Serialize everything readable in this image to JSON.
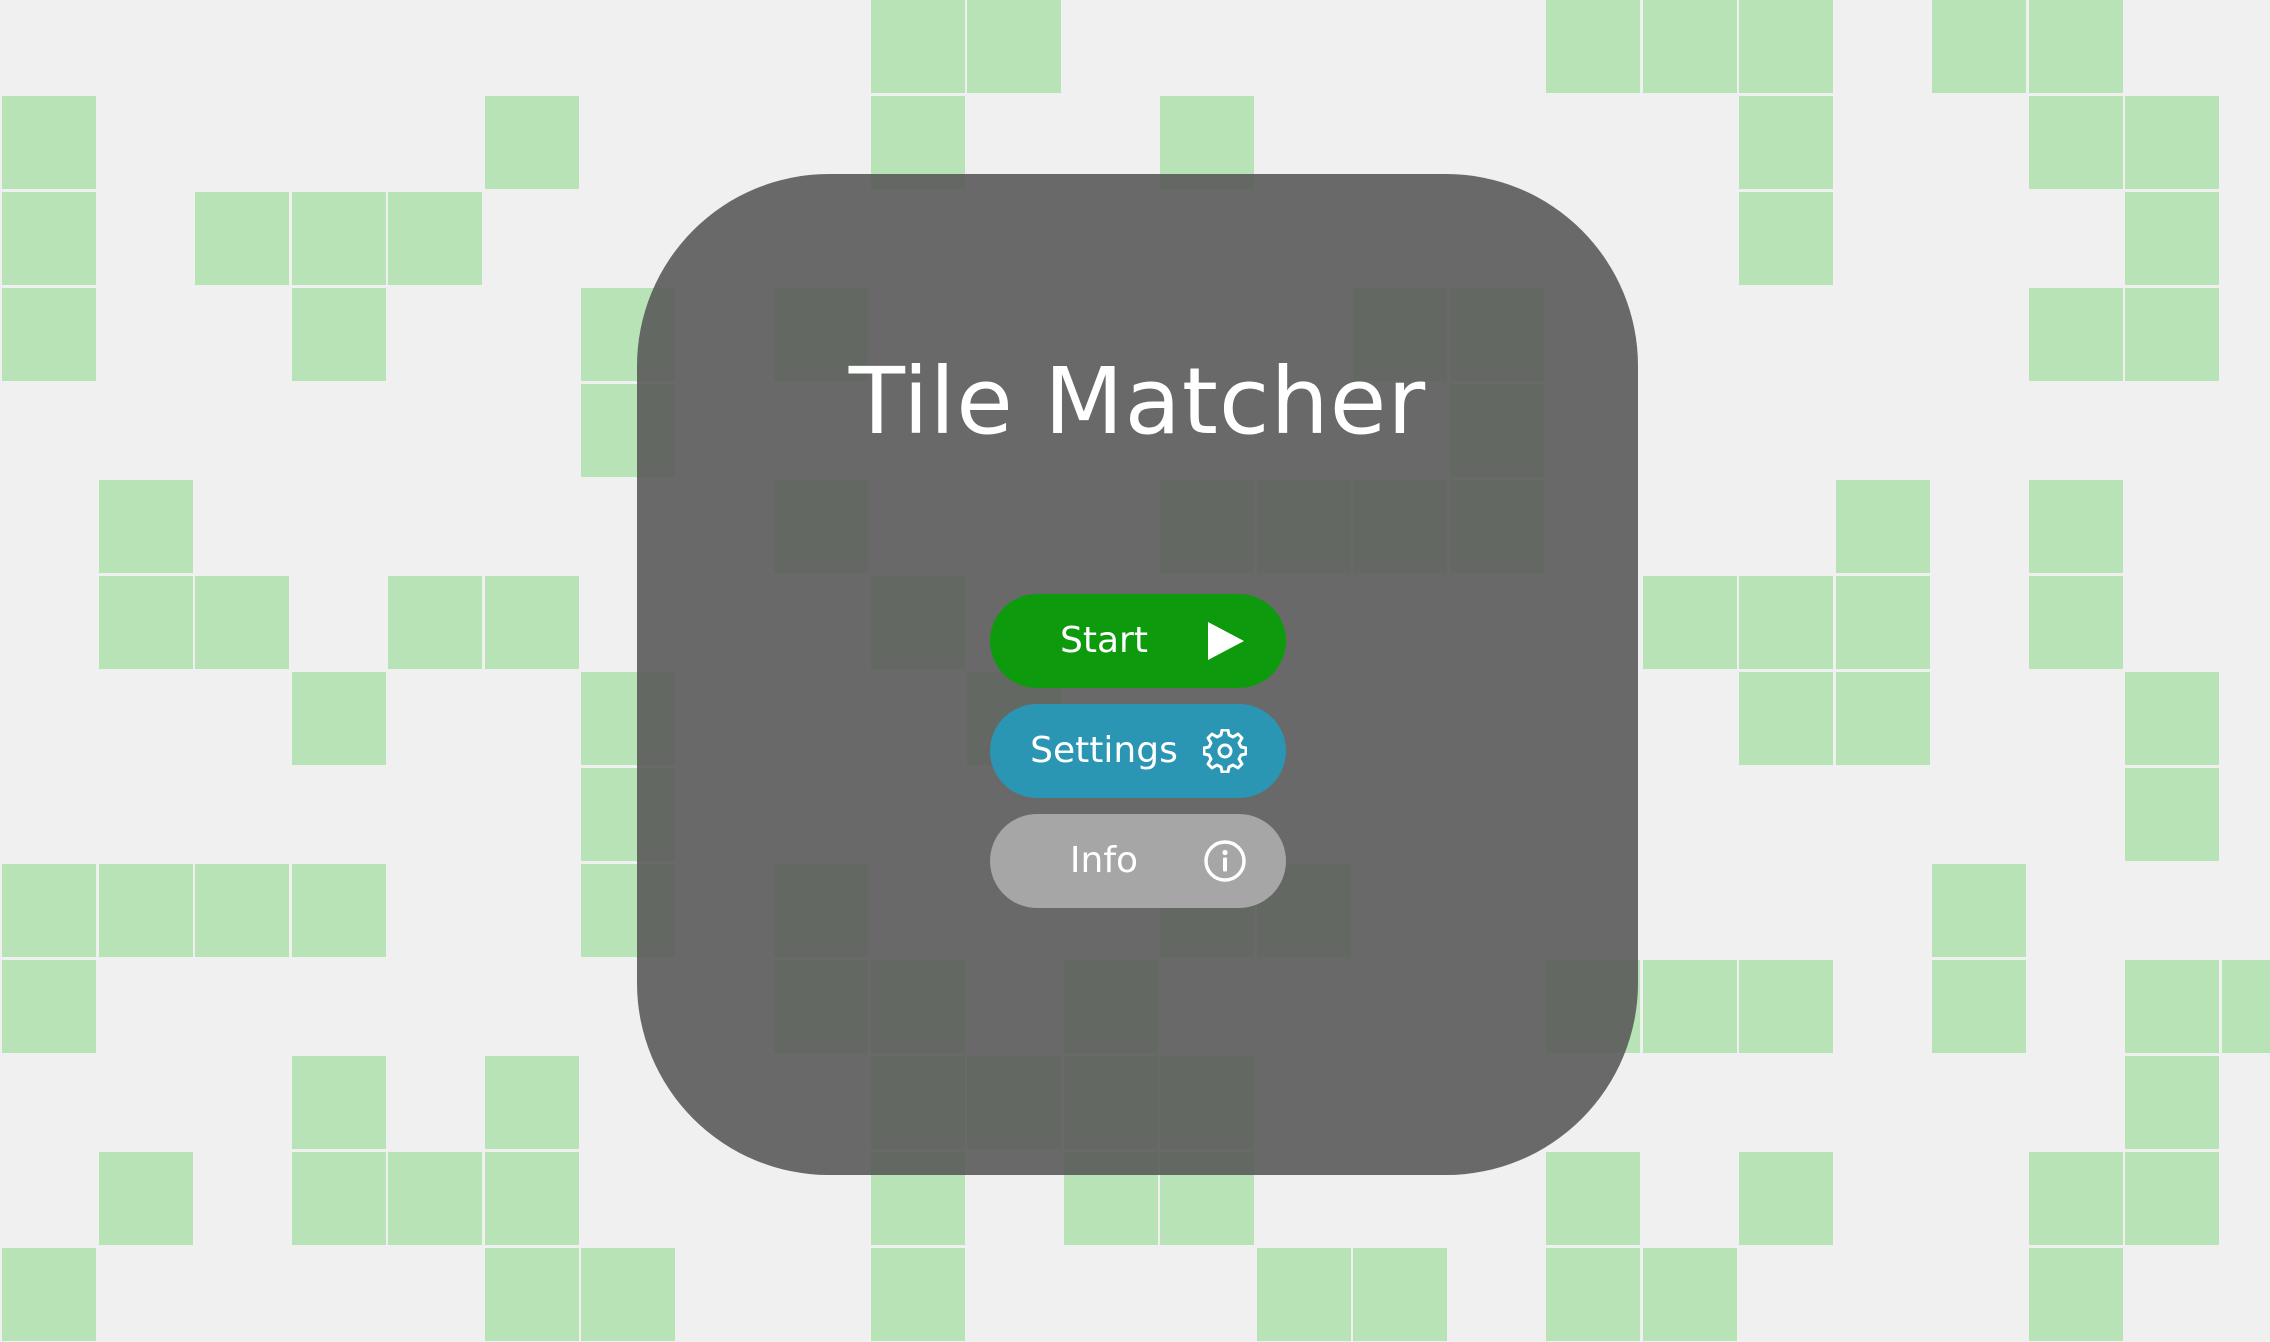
{
  "title": "Tile Matcher",
  "menu": {
    "start_label": "Start",
    "settings_label": "Settings",
    "info_label": "Info"
  },
  "colors": {
    "tile_filled": "#b8e3b6",
    "tile_empty": "#f0f0f0",
    "panel": "#5a5a5a",
    "start_button": "#0d9b0d",
    "settings_button": "#2a96b4",
    "info_button": "#a6a6a6"
  },
  "board": {
    "columns": 24,
    "rows": 14,
    "filled_tiles": [
      [
        0,
        9
      ],
      [
        0,
        10
      ],
      [
        0,
        16
      ],
      [
        0,
        17
      ],
      [
        0,
        18
      ],
      [
        0,
        20
      ],
      [
        0,
        21
      ],
      [
        1,
        0
      ],
      [
        1,
        5
      ],
      [
        1,
        9
      ],
      [
        1,
        12
      ],
      [
        1,
        18
      ],
      [
        1,
        21
      ],
      [
        1,
        22
      ],
      [
        2,
        0
      ],
      [
        2,
        2
      ],
      [
        2,
        3
      ],
      [
        2,
        4
      ],
      [
        2,
        18
      ],
      [
        2,
        22
      ],
      [
        3,
        0
      ],
      [
        3,
        3
      ],
      [
        3,
        6
      ],
      [
        3,
        8
      ],
      [
        3,
        14
      ],
      [
        3,
        15
      ],
      [
        3,
        21
      ],
      [
        3,
        22
      ],
      [
        4,
        6
      ],
      [
        4,
        15
      ],
      [
        5,
        1
      ],
      [
        5,
        8
      ],
      [
        5,
        12
      ],
      [
        5,
        13
      ],
      [
        5,
        14
      ],
      [
        5,
        15
      ],
      [
        5,
        19
      ],
      [
        5,
        21
      ],
      [
        6,
        1
      ],
      [
        6,
        2
      ],
      [
        6,
        4
      ],
      [
        6,
        5
      ],
      [
        6,
        9
      ],
      [
        6,
        17
      ],
      [
        6,
        18
      ],
      [
        6,
        19
      ],
      [
        6,
        21
      ],
      [
        7,
        3
      ],
      [
        7,
        6
      ],
      [
        7,
        10
      ],
      [
        7,
        18
      ],
      [
        7,
        19
      ],
      [
        7,
        22
      ],
      [
        8,
        6
      ],
      [
        8,
        22
      ],
      [
        9,
        0
      ],
      [
        9,
        1
      ],
      [
        9,
        2
      ],
      [
        9,
        3
      ],
      [
        9,
        6
      ],
      [
        9,
        8
      ],
      [
        9,
        12
      ],
      [
        9,
        13
      ],
      [
        9,
        20
      ],
      [
        10,
        0
      ],
      [
        10,
        8
      ],
      [
        10,
        9
      ],
      [
        10,
        11
      ],
      [
        10,
        16
      ],
      [
        10,
        17
      ],
      [
        10,
        18
      ],
      [
        10,
        20
      ],
      [
        10,
        22
      ],
      [
        10,
        23
      ],
      [
        11,
        3
      ],
      [
        11,
        5
      ],
      [
        11,
        9
      ],
      [
        11,
        10
      ],
      [
        11,
        11
      ],
      [
        11,
        12
      ],
      [
        11,
        22
      ],
      [
        12,
        1
      ],
      [
        12,
        3
      ],
      [
        12,
        4
      ],
      [
        12,
        5
      ],
      [
        12,
        9
      ],
      [
        12,
        11
      ],
      [
        12,
        12
      ],
      [
        12,
        16
      ],
      [
        12,
        18
      ],
      [
        12,
        21
      ],
      [
        12,
        22
      ],
      [
        13,
        0
      ],
      [
        13,
        5
      ],
      [
        13,
        6
      ],
      [
        13,
        9
      ],
      [
        13,
        13
      ],
      [
        13,
        14
      ],
      [
        13,
        16
      ],
      [
        13,
        17
      ],
      [
        13,
        21
      ]
    ]
  },
  "icons": {
    "start": "play-icon",
    "settings": "gear-icon",
    "info": "info-icon"
  }
}
